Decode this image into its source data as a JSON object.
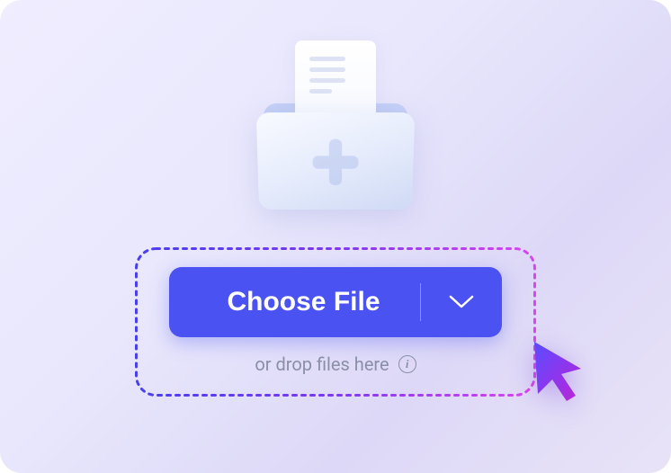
{
  "upload": {
    "button_label": "Choose File",
    "drop_hint": "or drop files here"
  },
  "colors": {
    "primary": "#4a52f2",
    "gradient_start": "#4a3fed",
    "gradient_end": "#d946ef"
  }
}
